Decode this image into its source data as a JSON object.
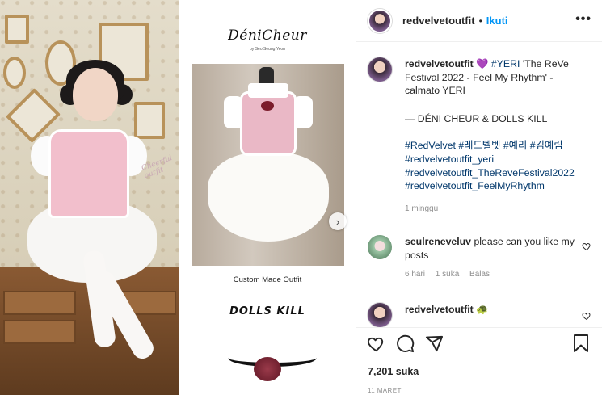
{
  "post": {
    "author": "redvelvetoutfit",
    "follow_label": "Ikuti",
    "more_label": "•••",
    "caption": {
      "line1_tags": "#YERI",
      "line1_text": " 'The ReVe Festival 2022 - Feel My Rhythm' - calmato YERI",
      "brands": "— DÉNI CHEUR & DOLLS KILL",
      "hashtags": [
        "#RedVelvet",
        "#레드벨벳",
        "#예리",
        "#김예림",
        "#redvelvetoutfit_yeri",
        "#redvelvetoutfit_TheReveFestival2022",
        "#redvelvetoutfit_FeelMyRhythm"
      ],
      "time": "1 minggu",
      "emoji": "💜"
    },
    "comments": [
      {
        "user": "seulreneveluv",
        "text": "please can you like my posts",
        "time": "6 hari",
        "likes": "1 suka",
        "reply": "Balas"
      },
      {
        "user": "redvelvetoutfit",
        "emoji": "🐢"
      }
    ],
    "likes_count": "7,201 suka",
    "date": "11 MARET"
  },
  "media": {
    "brand1": "DéniCheur",
    "brand1_sub": "by Seo Seung Yeon",
    "caption": "Custom Made Outfit",
    "brand2": "DOLLS KILL",
    "watermark": "Cheerful outfit",
    "next_arrow": "›"
  },
  "icons": [
    "heart-icon",
    "comment-icon",
    "share-icon",
    "bookmark-icon",
    "more-icon",
    "chevron-right-icon"
  ],
  "colors": {
    "link": "#0095f6",
    "hashtag": "#00376b",
    "meta": "#8e8e8e",
    "text": "#262626"
  }
}
